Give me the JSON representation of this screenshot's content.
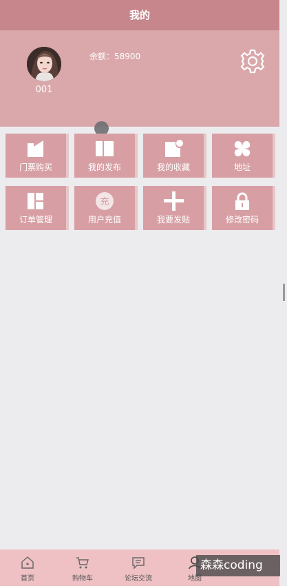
{
  "header": {
    "title": "我的"
  },
  "profile": {
    "username": "001",
    "balance_text": "余额：58900"
  },
  "menu": [
    {
      "label": "门票购买",
      "icon": "ticket-icon"
    },
    {
      "label": "我的发布",
      "icon": "book-icon"
    },
    {
      "label": "我的收藏",
      "icon": "favorite-icon"
    },
    {
      "label": "地址",
      "icon": "clover-icon"
    },
    {
      "label": "订单管理",
      "icon": "layout-icon"
    },
    {
      "label": "用户充值",
      "icon": "recharge-icon",
      "icon_text": "充"
    },
    {
      "label": "我要发贴",
      "icon": "plus-icon"
    },
    {
      "label": "修改密码",
      "icon": "lock-icon"
    }
  ],
  "tabbar": [
    {
      "label": "首页",
      "icon": "home-icon"
    },
    {
      "label": "购物车",
      "icon": "cart-icon"
    },
    {
      "label": "论坛交流",
      "icon": "chat-icon"
    },
    {
      "label": "地图",
      "icon": "user-icon"
    }
  ],
  "watermark": "森森coding",
  "colors": {
    "header_bg": "#c7868b",
    "profile_bg": "#daa7ab",
    "tile_bg": "#d79fa4",
    "tabbar_bg": "#efc1c4",
    "page_bg": "#ececee"
  }
}
